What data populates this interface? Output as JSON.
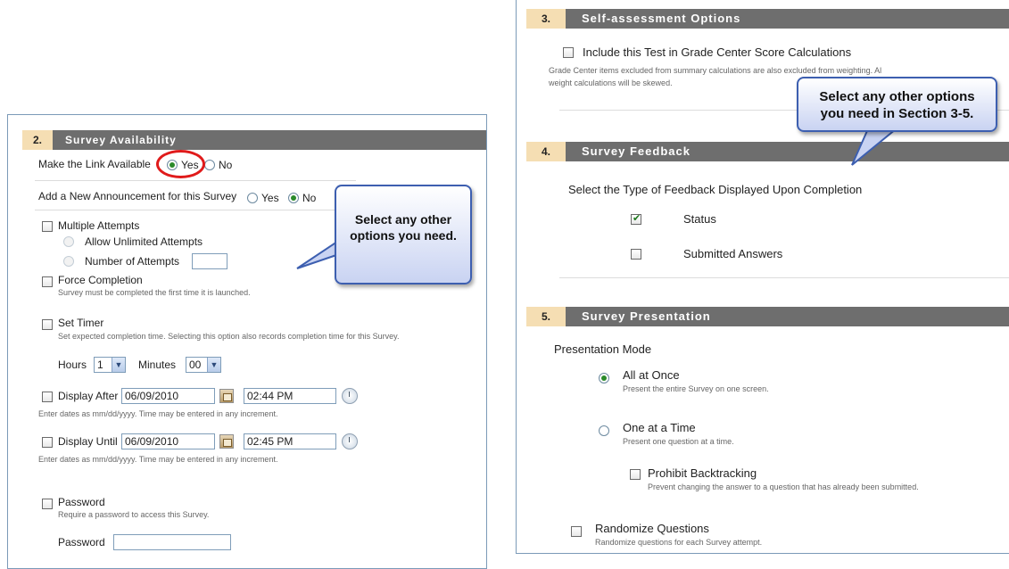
{
  "left": {
    "section": {
      "number": "2.",
      "title": "Survey Availability"
    },
    "make_link": {
      "label": "Make the Link Available",
      "yes": "Yes",
      "no": "No"
    },
    "announcement": {
      "label": "Add a New Announcement for this Survey",
      "yes": "Yes",
      "no": "No"
    },
    "multiple_attempts": {
      "label": "Multiple Attempts",
      "unlimited": "Allow Unlimited Attempts",
      "number": "Number of Attempts"
    },
    "force_completion": {
      "label": "Force Completion",
      "help": "Survey must be completed the first time it is launched."
    },
    "set_timer": {
      "label": "Set Timer",
      "help": "Set expected completion time. Selecting this option also records completion time for this Survey."
    },
    "hours": {
      "label": "Hours",
      "value": "1"
    },
    "minutes": {
      "label": "Minutes",
      "value": "00"
    },
    "display_after": {
      "label": "Display After",
      "date": "06/09/2010",
      "time": "02:44 PM",
      "help": "Enter dates as mm/dd/yyyy. Time may be entered in any increment."
    },
    "display_until": {
      "label": "Display Until",
      "date": "06/09/2010",
      "time": "02:45 PM",
      "help": "Enter dates as mm/dd/yyyy. Time may be entered in any increment."
    },
    "password": {
      "label": "Password",
      "help": "Require a password to access this Survey.",
      "field_label": "Password"
    },
    "callout": {
      "line1": "Select any other",
      "line2": "options you need."
    }
  },
  "right": {
    "section3": {
      "number": "3.",
      "title": "Self-assessment Options"
    },
    "grade_center": {
      "label": "Include this Test in Grade Center Score Calculations",
      "help1": "Grade Center items excluded from summary calculations are also excluded from weighting. Al",
      "help2": "weight calculations will be skewed."
    },
    "section4": {
      "number": "4.",
      "title": "Survey Feedback"
    },
    "feedback": {
      "label": "Select the Type of Feedback Displayed Upon Completion",
      "status": "Status",
      "submitted": "Submitted Answers"
    },
    "section5": {
      "number": "5.",
      "title": "Survey Presentation"
    },
    "presentation": {
      "label": "Presentation Mode",
      "all_at_once": "All at Once",
      "all_at_once_help": "Present the entire Survey on one screen.",
      "one_at_a_time": "One at a Time",
      "one_at_a_time_help": "Present one question at a time.",
      "prohibit": "Prohibit Backtracking",
      "prohibit_help": "Prevent changing the answer to a question that has already been submitted.",
      "randomize": "Randomize Questions",
      "randomize_help": "Randomize questions for each Survey attempt."
    },
    "callout": {
      "line1": "Select any other options",
      "line2": "you need in Section 3-5."
    }
  },
  "colors": {
    "section_bar": "#6e6e6e",
    "section_number_bg": "#f5deb3",
    "callout_border": "#3d5fb0",
    "highlight_ring": "#e01b1b"
  }
}
